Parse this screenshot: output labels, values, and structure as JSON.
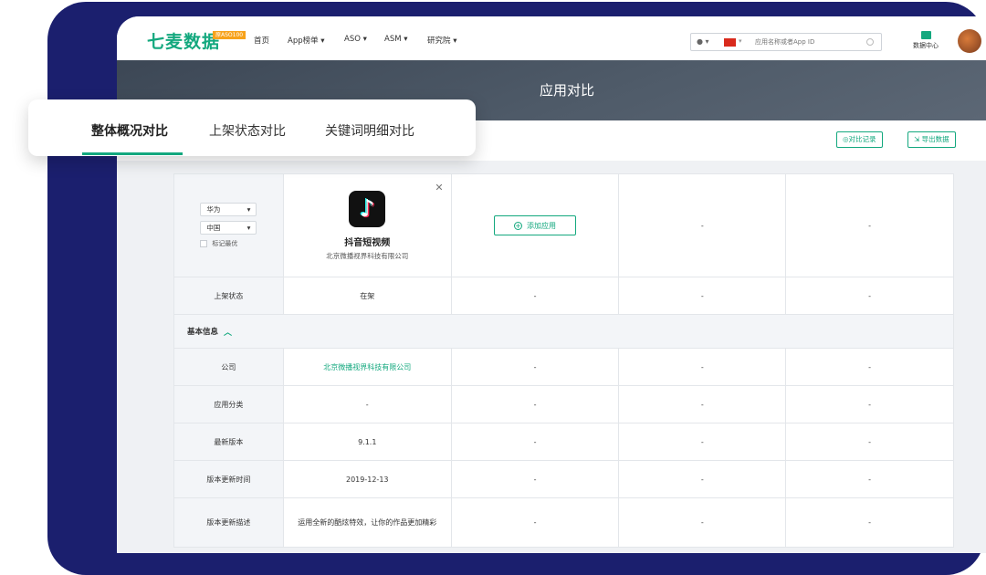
{
  "nav": {
    "logo": "七麦数据",
    "badge": "原ASO100",
    "items": [
      "首页",
      "App榜单 ▾",
      "ASO ▾",
      "ASM ▾",
      "研究院 ▾"
    ],
    "search_placeholder": "应用名称或者App ID",
    "os_select": " ▾",
    "data_center": "数据中心"
  },
  "banner": {
    "title": "应用对比"
  },
  "tabs": [
    "整体概况对比",
    "上架状态对比",
    "关键词明细对比"
  ],
  "toolbar": {
    "compare_records": "◎对比记录",
    "export": "⇲ 导出数据"
  },
  "controls": {
    "store": "华为",
    "country": "中国",
    "mark_best": "标记最优"
  },
  "app": {
    "name": "抖音短视频",
    "company": "北京微播视界科技有限公司",
    "icon_glyph": "♪"
  },
  "add_app": "添加应用",
  "dash": "-",
  "section": {
    "title": "基本信息"
  },
  "status_row": {
    "label": "上架状态",
    "value": "在架"
  },
  "rows": [
    {
      "label": "公司",
      "value": "北京微播视界科技有限公司",
      "link": true
    },
    {
      "label": "应用分类",
      "value": "-"
    },
    {
      "label": "最新版本",
      "value": "9.1.1"
    },
    {
      "label": "版本更新时间",
      "value": "2019-12-13"
    },
    {
      "label": "版本更新描述",
      "value": "运用全新的酷炫特效，让你的作品更加精彩"
    }
  ],
  "colors": {
    "accent": "#13a87e",
    "frame": "#1b1f6e",
    "banner": "#4f5b69"
  }
}
